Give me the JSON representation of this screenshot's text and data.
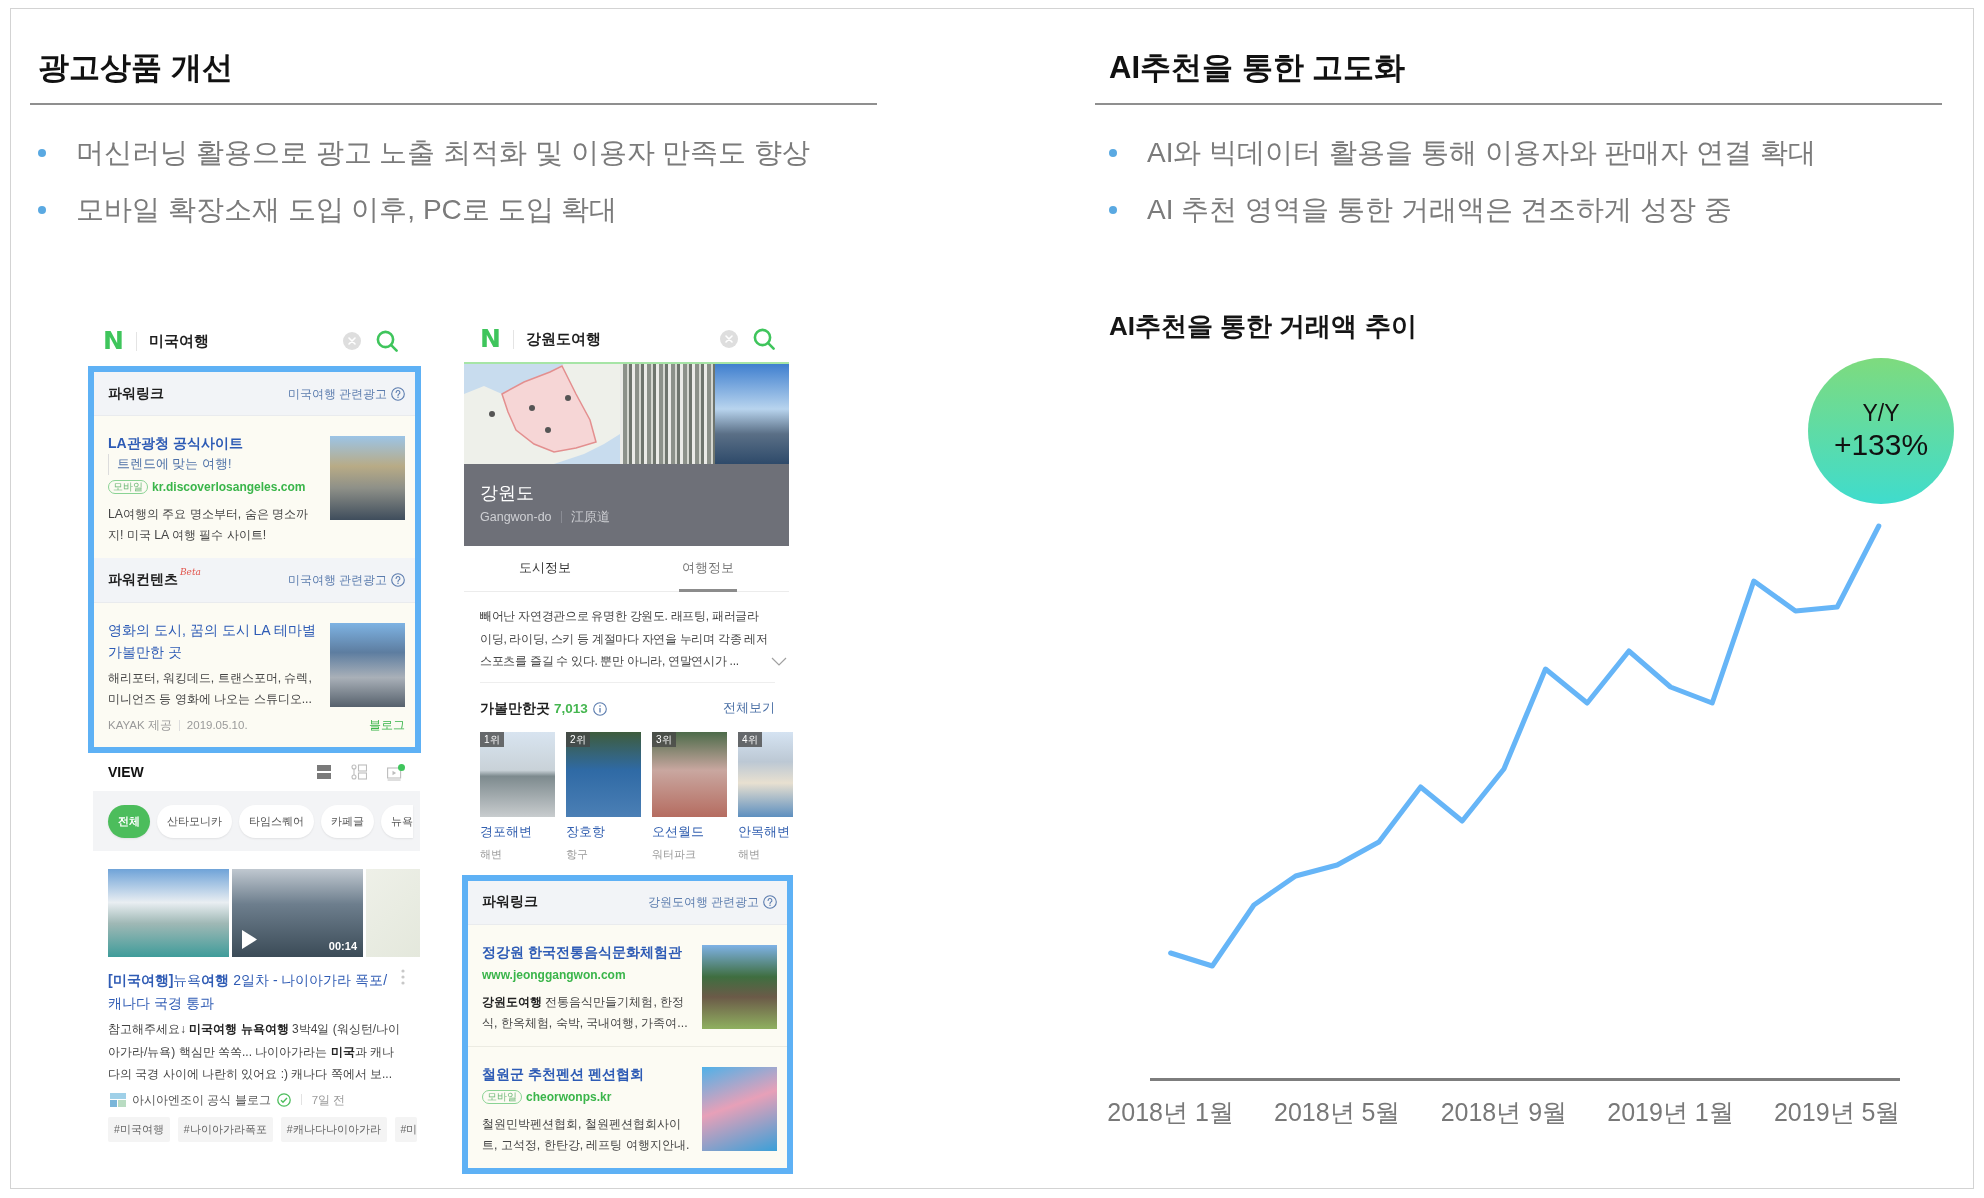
{
  "left_panel": {
    "heading": "광고상품 개선",
    "bullets": [
      "머신러닝 활용으로 광고 노출 최적화 및 이용자 만족도 향상",
      "모바일 확장소재 도입 이후, PC로 도입 확대"
    ],
    "mobile_screens": [
      {
        "logo": "N",
        "query": "미국여행",
        "blocks": [
          {
            "kind": "ads",
            "sections": [
              {
                "kind": "powerlink",
                "title": "파워링크",
                "related": "미국여행 관련광고",
                "items": [
                  {
                    "title": "LA관광청 공식사이트",
                    "subtitle": "트렌드에 맞는 여행!",
                    "mobile_tag": "모바일",
                    "url": "kr.discoverlosangeles.com",
                    "description": "LA여행의 주요 명소부터, 숨은 명소까지! 미국 LA 여행 필수 사이트!"
                  }
                ]
              },
              {
                "kind": "powercontents",
                "title": "파워컨텐츠",
                "beta": "Beta",
                "related": "미국여행 관련광고",
                "items": [
                  {
                    "title": "영화의 도시, 꿈의 도시 LA 테마별 가볼만한 곳",
                    "description": "해리포터, 워킹데드, 트랜스포머, 슈렉, 미니언즈 등 영화에 나오는 스튜디오...",
                    "provider": "KAYAK 제공",
                    "date": "2019.05.10.",
                    "source": "블로그"
                  }
                ]
              }
            ]
          },
          {
            "kind": "view",
            "title": "VIEW",
            "chips": [
              {
                "label": "전체",
                "selected": true
              },
              {
                "label": "산타모니카",
                "selected": false
              },
              {
                "label": "타임스퀘어",
                "selected": false
              },
              {
                "label": "카페글",
                "selected": false
              },
              {
                "label": "뉴욕",
                "selected": false
              }
            ],
            "media": [
              {
                "kind": "photo"
              },
              {
                "kind": "video",
                "duration": "00:14"
              },
              {
                "kind": "map"
              }
            ],
            "post": {
              "title": "**[미국여행]**뉴욕**여행** 2일차 - 나이아가라 폭포/캐나다 국경 통과",
              "description": "참고해주세요↓ **미국여행** **뉴욕여행** 3박4일 (워싱턴/나이아가라/뉴욕) 핵심만 쏙쏙... 나이아가라는 **미국**과 캐나다의 국경 사이에 나란히 있어요 :) 캐나다 쪽에서 보...",
              "author": "아시아엔조이 공식 블로그",
              "verified": true,
              "time": "7일 전",
              "tags": [
                "#미국여행",
                "#나이아가라폭포",
                "#캐나다나이아가라",
                "#미"
              ]
            }
          }
        ]
      },
      {
        "logo": "N",
        "query": "강원도여행",
        "blocks": [
          {
            "kind": "region",
            "name": "강원도",
            "romanized": "Gangwon-do",
            "hanja": "江原道",
            "tabs": [
              {
                "label": "도시정보",
                "selected": false
              },
              {
                "label": "여행정보",
                "selected": true
              }
            ],
            "description": "빼어난 자연경관으로 유명한 강원도. 래프팅, 패러글라이딩, 라이딩, 스키 등 계절마다 자연을 누리며 각종 레저 스포츠를 즐길 수 있다. 뿐만 아니라, 연말연시가 ..."
          },
          {
            "kind": "places",
            "title": "가볼만한곳",
            "count": "7,013",
            "more": "전체보기",
            "items": [
              {
                "rank": "1위",
                "name": "경포해변",
                "category": "해변"
              },
              {
                "rank": "2위",
                "name": "장호항",
                "category": "항구"
              },
              {
                "rank": "3위",
                "name": "오션월드",
                "category": "워터파크"
              },
              {
                "rank": "4위",
                "name": "안목해변",
                "category": "해변"
              }
            ]
          },
          {
            "kind": "ads",
            "sections": [
              {
                "kind": "powerlink",
                "title": "파워링크",
                "related": "강원도여행 관련광고",
                "items": [
                  {
                    "title": "정강원 한국전통음식문화체험관",
                    "url": "www.jeonggangwon.com",
                    "description": "**강원도여행** 전통음식만들기체험, 한정식, 한옥체험, 숙박, 국내여행, 가족여..."
                  },
                  {
                    "title": "철원군 추천펜션 펜션협회",
                    "mobile_tag": "모바일",
                    "url": "cheorwonps.kr",
                    "description": "철원민박펜션협회, 철원펜션협회사이트, 고석정, 한탄강, 레프팅 여행지안내."
                  }
                ]
              }
            ]
          }
        ]
      }
    ]
  },
  "right_panel": {
    "heading": "AI추천을 통한 고도화",
    "bullets": [
      "AI와 빅데이터 활용을 통해 이용자와 판매자 연결 확대",
      "AI 추천 영역을 통한 거래액은 견조하게 성장 중"
    ],
    "chart": {
      "title": "AI추천을 통한 거래액 추이",
      "x_labels": [
        "2018년 1월",
        "2018년 5월",
        "2018년 9월",
        "2019년 1월",
        "2019년 5월"
      ],
      "badge": {
        "label": "Y/Y",
        "value": "+133%"
      }
    }
  }
}
